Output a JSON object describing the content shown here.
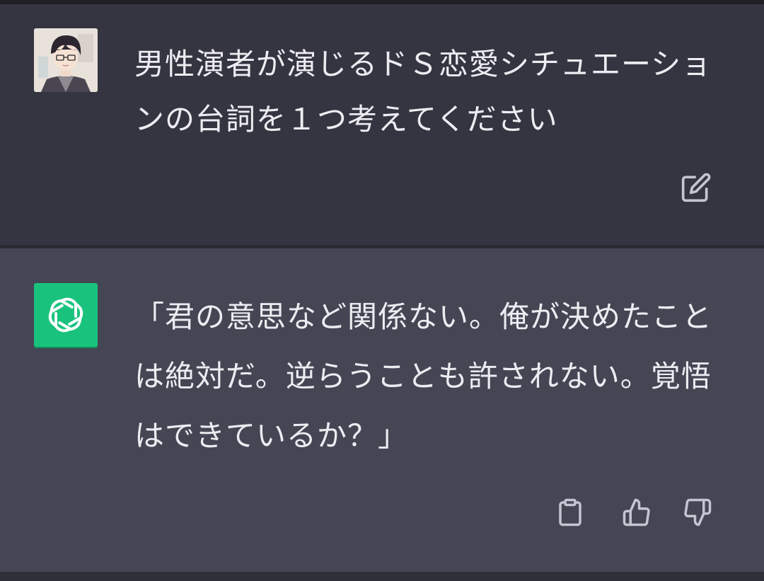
{
  "conversation": {
    "user_message": {
      "text": "男性演者が演じるドＳ恋愛シチュエーションの台詞を１つ考えてください",
      "avatar_icon": "user-avatar-illustration",
      "edit_icon": "edit-icon"
    },
    "assistant_message": {
      "text": "「君の意思など関係ない。俺が決めたことは絶対だ。逆らうことも許されない。覚悟はできているか？」",
      "logo_icon": "openai-logo-icon",
      "action_icons": [
        "clipboard-icon",
        "thumbs-up-icon",
        "thumbs-down-icon"
      ]
    }
  },
  "colors": {
    "user_background": "#343541",
    "assistant_background": "#444654",
    "logo_background": "#19c37d",
    "text": "#ececf1",
    "icon": "#c5c5d2"
  }
}
